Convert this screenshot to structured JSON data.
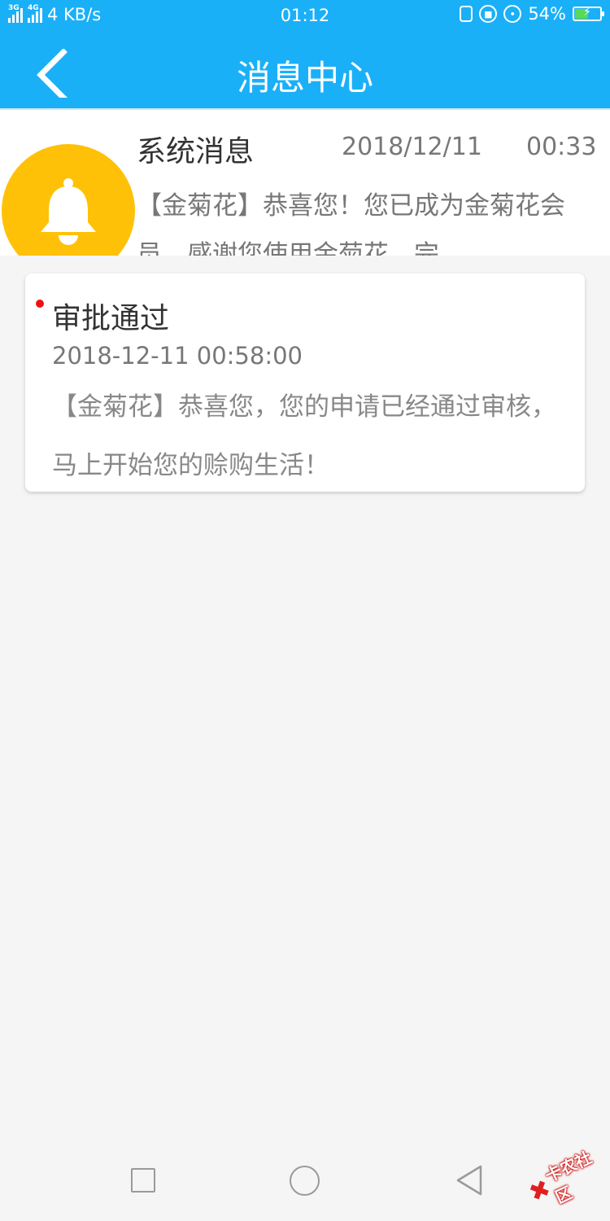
{
  "status_bar": {
    "network_3g": "3G",
    "network_4g": "4G",
    "speed": "4 KB/s",
    "time": "01:12",
    "battery": "54%",
    "battery_level": 0.54,
    "icons": [
      "vibrate-icon",
      "rotation-lock-icon",
      "alarm-icon",
      "battery-icon"
    ]
  },
  "header": {
    "title": "消息中心",
    "back_icon": "chevron-left-icon"
  },
  "system_message": {
    "icon": "bell-icon",
    "avatar_color": "#ffc107",
    "title": "系统消息",
    "date": "2018/12/11",
    "time": "00:33",
    "preview": "【金菊花】恭喜您！您已成为金菊花会员，感谢您使用金菊花，完"
  },
  "approval_card": {
    "title": "审批通过",
    "datetime": "2018-12-11 00:58:00",
    "body": "【金菊花】恭喜您，您的申请已经通过审核，马上开始您的赊购生活！"
  },
  "watermark": {
    "text": "卡农社区"
  },
  "colors": {
    "primary": "#1ab0f8",
    "unread_dot": "#ee1111",
    "background": "#f5f5f5"
  }
}
